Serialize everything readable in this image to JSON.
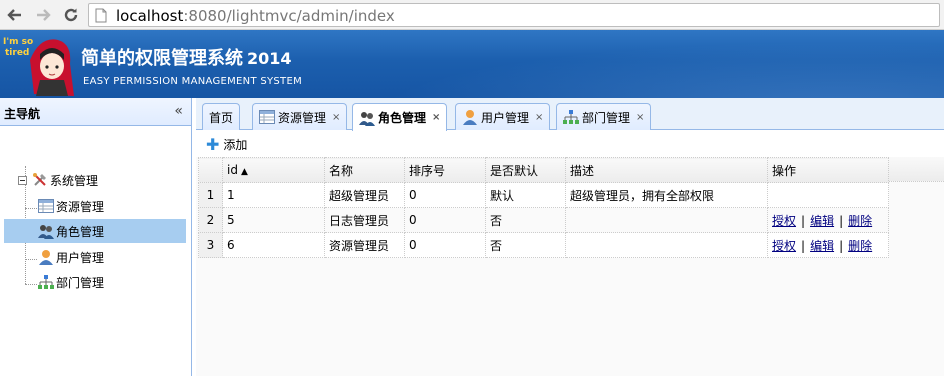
{
  "browser": {
    "url_host": "localhost",
    "url_rest": ":8080/lightmvc/admin/index"
  },
  "header": {
    "title": "简单的权限管理系统",
    "year": "2014",
    "subtitle": "EASY PERMISSION MANAGEMENT SYSTEM",
    "logo_text": "I'm so tired"
  },
  "sidebar": {
    "title": "主导航",
    "collapse": "«",
    "root": {
      "label": "系统管理",
      "icon": "tools-icon"
    },
    "items": [
      {
        "label": "资源管理",
        "icon": "resource-icon",
        "selected": false
      },
      {
        "label": "角色管理",
        "icon": "role-icon",
        "selected": true
      },
      {
        "label": "用户管理",
        "icon": "user-icon",
        "selected": false
      },
      {
        "label": "部门管理",
        "icon": "org-chart-icon",
        "selected": false
      }
    ]
  },
  "tabs": [
    {
      "label": "首页",
      "closable": false,
      "active": false
    },
    {
      "label": "资源管理",
      "closable": true,
      "active": false
    },
    {
      "label": "角色管理",
      "closable": true,
      "active": true
    },
    {
      "label": "用户管理",
      "closable": true,
      "active": false
    },
    {
      "label": "部门管理",
      "closable": true,
      "active": false
    }
  ],
  "tab_close_glyph": "×",
  "toolbar": {
    "add_label": "添加"
  },
  "grid": {
    "columns": [
      "id",
      "名称",
      "排序号",
      "是否默认",
      "描述",
      "操作"
    ],
    "sort_indicator": "▲",
    "rows": [
      {
        "num": "1",
        "id": "1",
        "name": "超级管理员",
        "order": "0",
        "is_default": "默认",
        "desc": "超级管理员，拥有全部权限",
        "ops": []
      },
      {
        "num": "2",
        "id": "5",
        "name": "日志管理员",
        "order": "0",
        "is_default": "否",
        "desc": "",
        "ops": [
          "授权",
          "编辑",
          "删除"
        ]
      },
      {
        "num": "3",
        "id": "6",
        "name": "资源管理员",
        "order": "0",
        "is_default": "否",
        "desc": "",
        "ops": [
          "授权",
          "编辑",
          "删除"
        ]
      }
    ],
    "op_separator": "|"
  },
  "colors": {
    "header_blue": "#1c5fae",
    "selected_row": "#a7cdf0",
    "link": "#000080",
    "border": "#95b8e7"
  }
}
